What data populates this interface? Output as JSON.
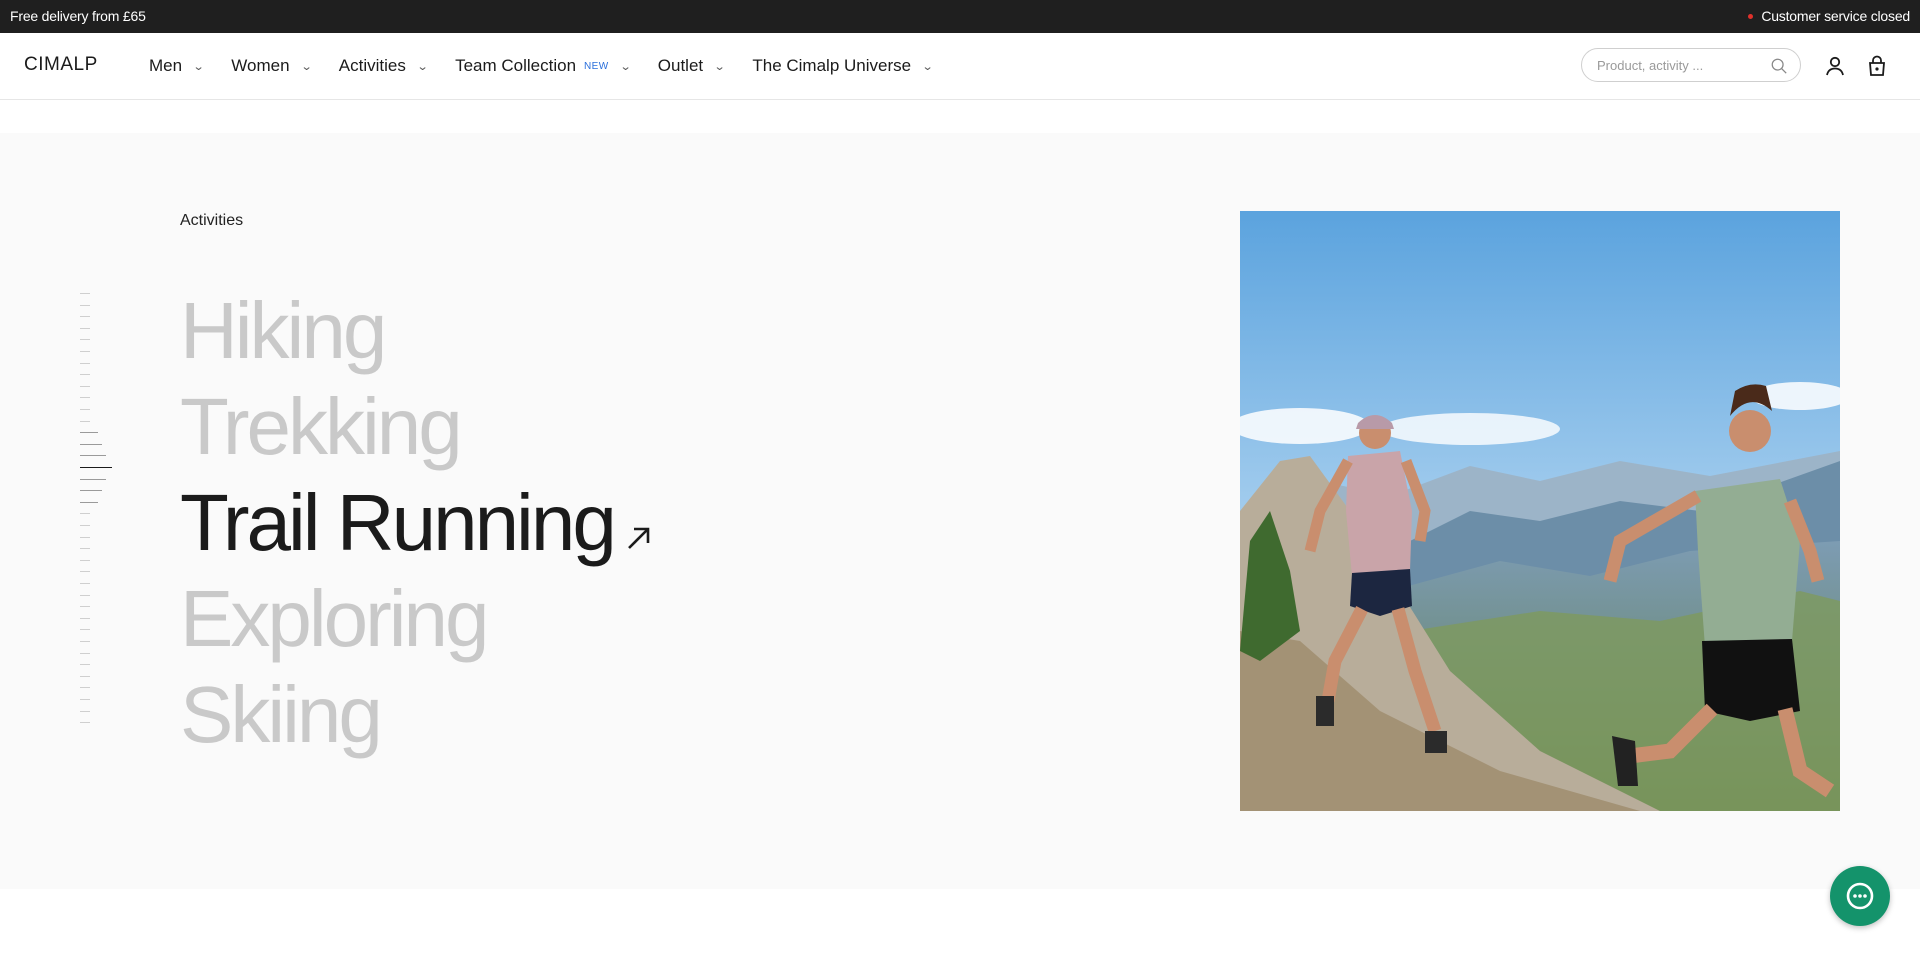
{
  "topbar": {
    "promo": "Free delivery from £65",
    "service_status": "Customer service closed",
    "status_color": "#e0312b"
  },
  "header": {
    "logo": "CIMALP",
    "nav": [
      {
        "label": "Men"
      },
      {
        "label": "Women"
      },
      {
        "label": "Activities"
      },
      {
        "label": "Team Collection",
        "badge": "NEW"
      },
      {
        "label": "Outlet"
      },
      {
        "label": "The Cimalp Universe"
      }
    ],
    "search_placeholder": "Product, activity ...",
    "icons": [
      "search-icon",
      "account-icon",
      "cart-icon",
      "chevron-down-icon"
    ]
  },
  "hero": {
    "eyebrow": "Activities",
    "activities": [
      {
        "label": "Hiking",
        "active": false
      },
      {
        "label": "Trekking",
        "active": false
      },
      {
        "label": "Trail Running",
        "active": true
      },
      {
        "label": "Exploring",
        "active": false
      },
      {
        "label": "Skiing",
        "active": false
      }
    ]
  },
  "colors": {
    "topbar_bg": "#1f1f1f",
    "hero_bg": "#fafafa",
    "inactive_text": "#c9c9c9",
    "active_text": "#1b1b1b",
    "chat_bg": "#14936b",
    "badge": "#2a6fdb"
  }
}
